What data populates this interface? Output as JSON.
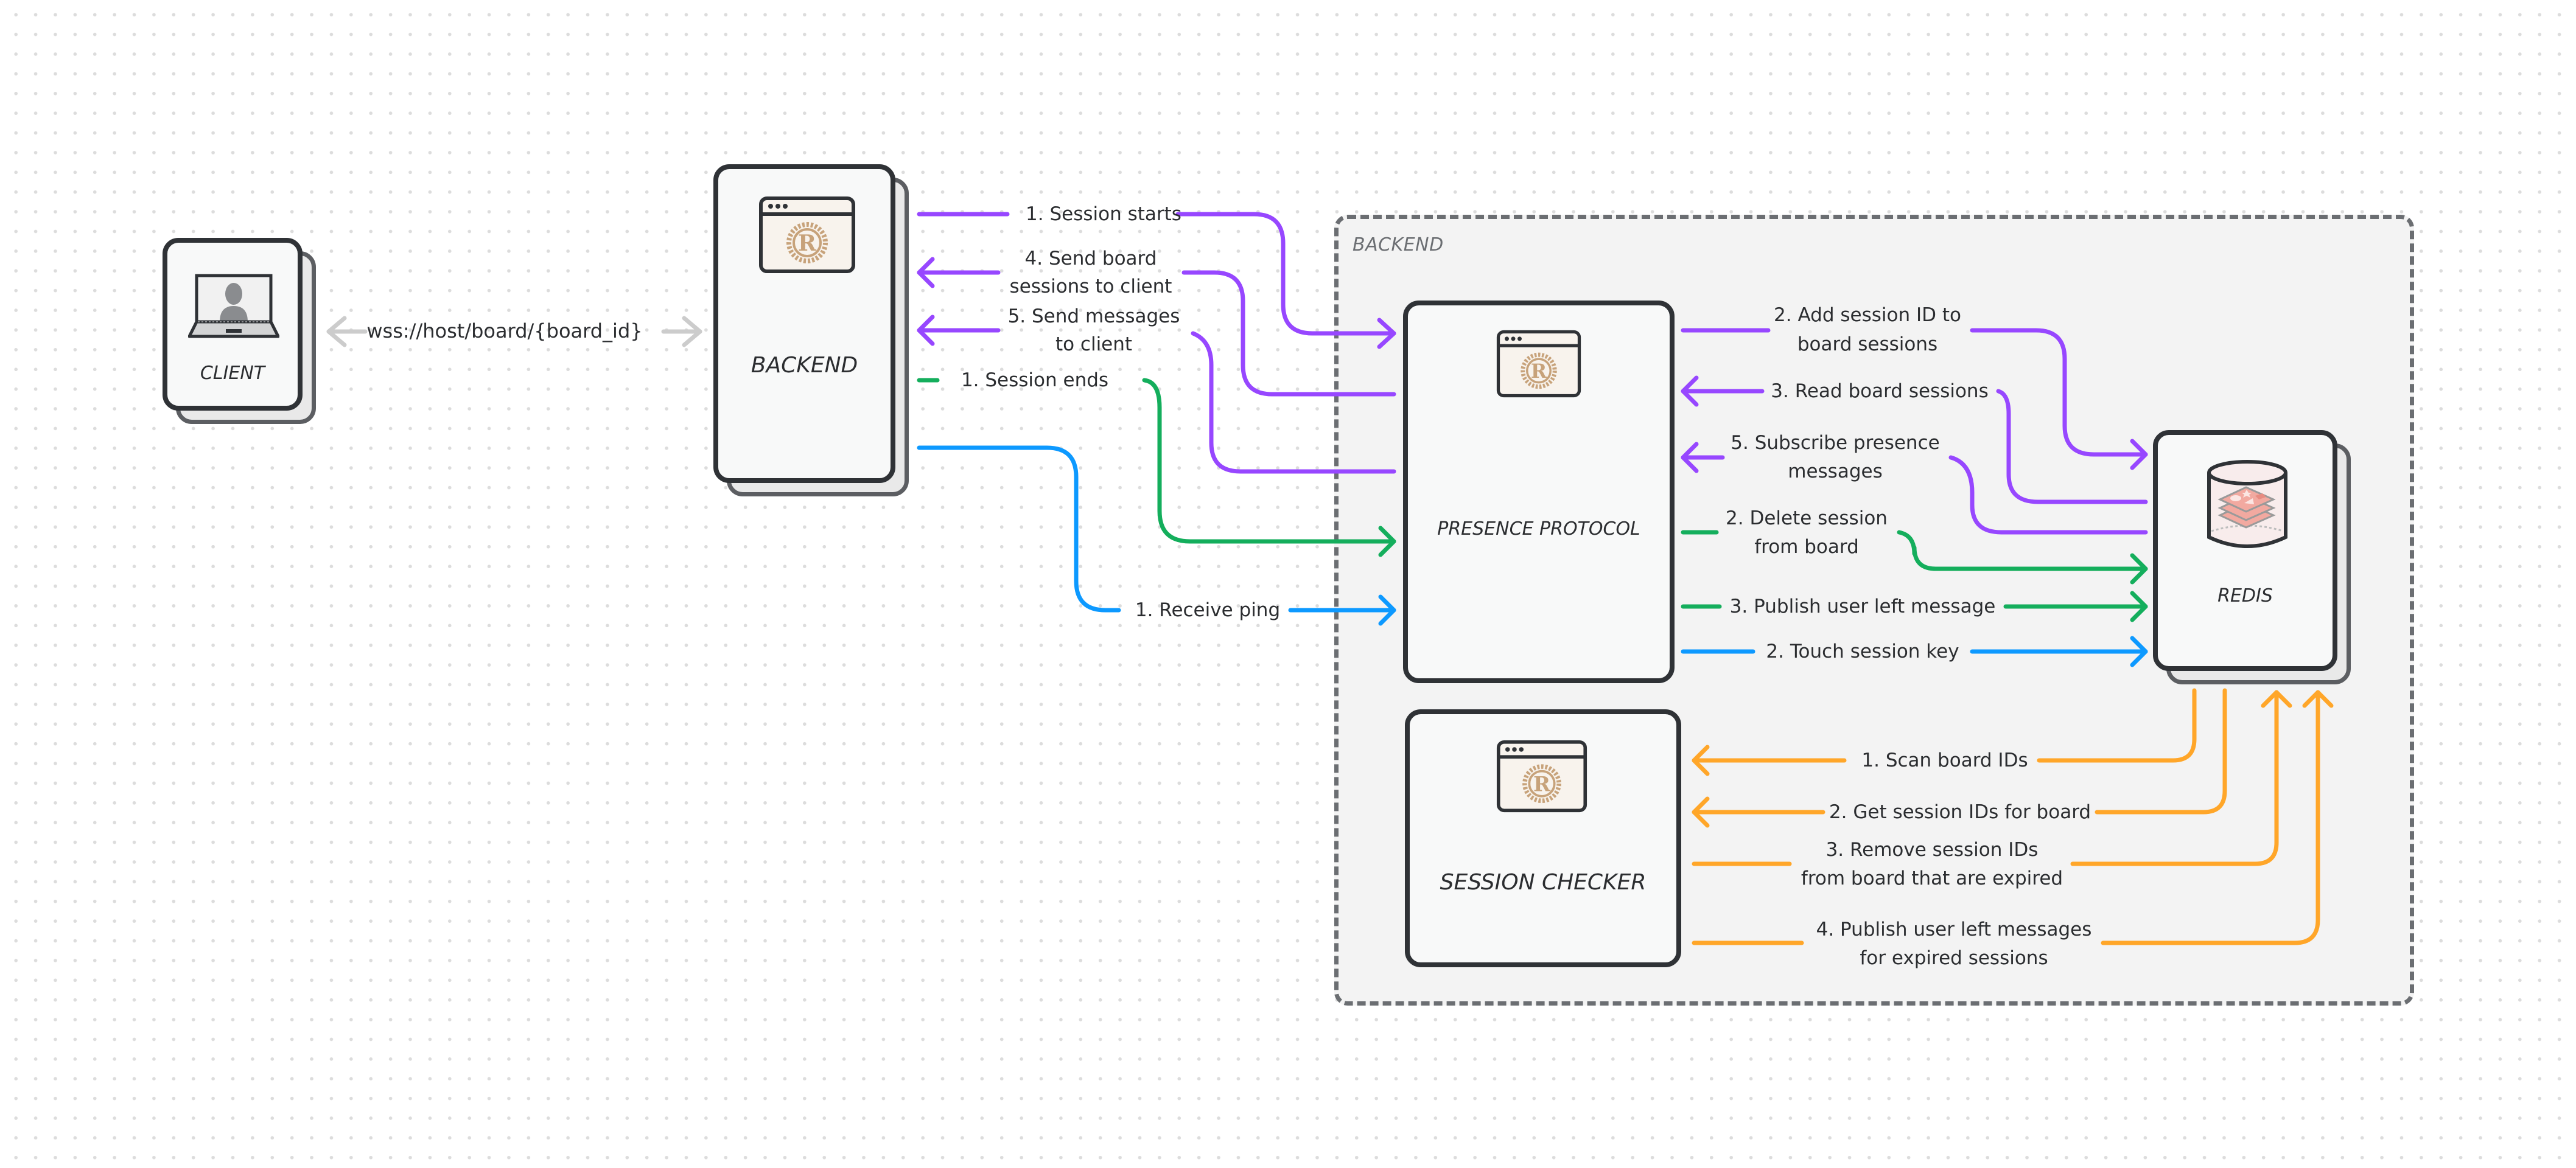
{
  "nodes": {
    "client": {
      "label": "CLIENT",
      "icon": "laptop-user-icon"
    },
    "backend": {
      "label": "BACKEND",
      "icon": "rust-window-icon"
    },
    "presence": {
      "label": "PRESENCE PROTOCOL",
      "icon": "rust-window-icon"
    },
    "session_checker": {
      "label": "SESSION CHECKER",
      "icon": "rust-window-icon"
    },
    "redis": {
      "label": "REDIS",
      "icon": "redis-database-icon"
    }
  },
  "group": {
    "label": "BACKEND"
  },
  "connection": {
    "websocket": "wss://host/board/{board_id}"
  },
  "colors": {
    "purple": "#9747ff",
    "green": "#14ae5c",
    "blue": "#0d99ff",
    "orange": "#ffa629",
    "gray_arrow": "#cccccc",
    "border": "#2f3236",
    "group_border": "#6b6e72"
  },
  "edges": {
    "backend_presence": [
      {
        "text": "1. Session starts",
        "color": "purple"
      },
      {
        "text": "4. Send board\nsessions to client",
        "line1": "4. Send board",
        "line2": "sessions to client",
        "color": "purple"
      },
      {
        "text": "5. Send messages\nto client",
        "line1": "5. Send messages",
        "line2": "to client",
        "color": "purple"
      },
      {
        "text": "1. Session ends",
        "color": "green"
      },
      {
        "text": "1. Receive ping",
        "color": "blue"
      }
    ],
    "presence_redis": [
      {
        "line1": "2. Add session ID to",
        "line2": "board sessions",
        "color": "purple"
      },
      {
        "text": "3. Read board sessions",
        "color": "purple"
      },
      {
        "line1": "5. Subscribe presence",
        "line2": "messages",
        "color": "purple"
      },
      {
        "line1": "2. Delete session",
        "line2": "from board",
        "color": "green"
      },
      {
        "text": "3. Publish user left message",
        "color": "green"
      },
      {
        "text": "2. Touch session key",
        "color": "blue"
      }
    ],
    "checker_redis": [
      {
        "text": "1. Scan board IDs",
        "color": "orange"
      },
      {
        "text": "2. Get session IDs for board",
        "color": "orange"
      },
      {
        "line1": "3. Remove session IDs",
        "line2": "from board that are expired",
        "color": "orange"
      },
      {
        "line1": "4. Publish user left messages",
        "line2": "for expired sessions",
        "color": "orange"
      }
    ]
  }
}
